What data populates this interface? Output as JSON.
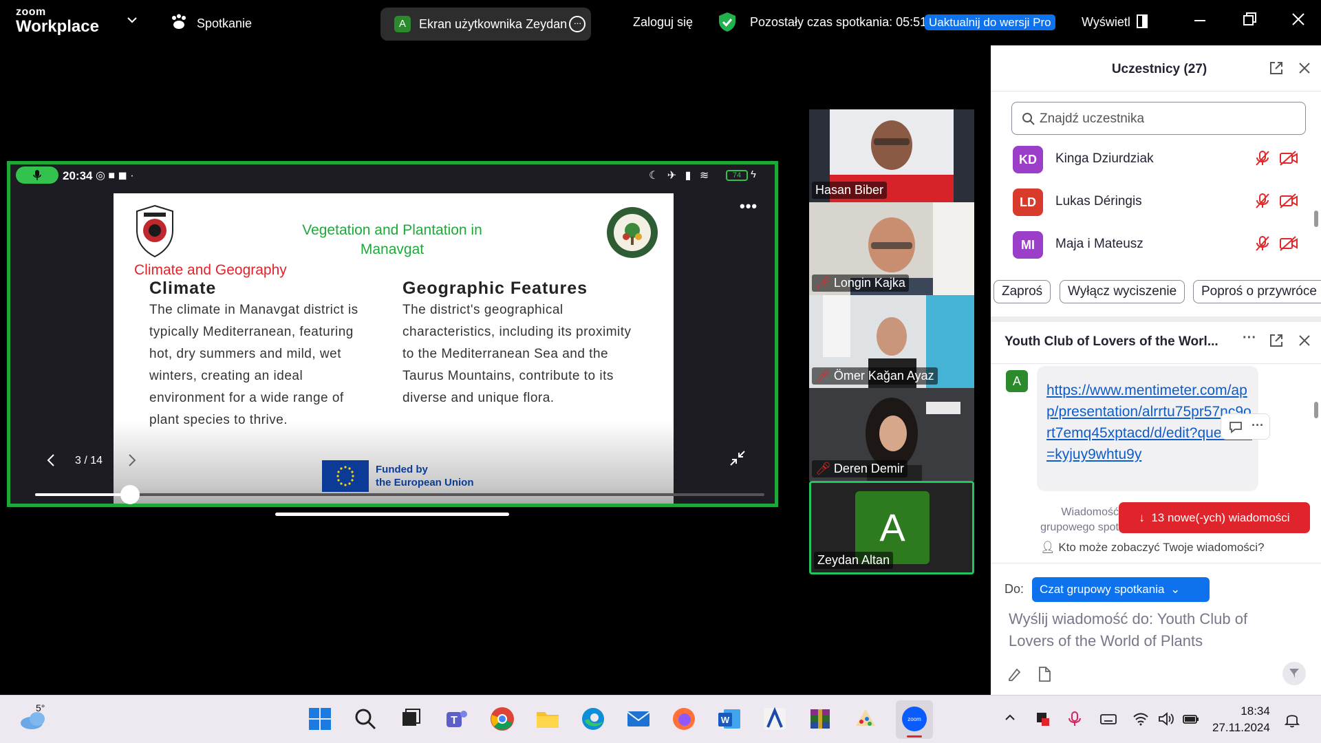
{
  "topbar": {
    "logo_small": "zoom",
    "logo_big": "Workplace",
    "meeting_label": "Spotkanie",
    "share_avatar": "A",
    "share_label": "Ekran użytkownika Zeydan",
    "login": "Zaloguj się",
    "time_left": "Pozostały czas spotkania: 05:51",
    "upgrade": "Uaktualnij do wersji Pro",
    "view": "Wyświetl"
  },
  "phone": {
    "time": "20:34",
    "battery": "74"
  },
  "slide": {
    "title": "Vegetation and Plantation in Manavgat",
    "section": "Climate and Geography",
    "col1_heading": "Climate",
    "col1_body": "The climate in Manavgat district is typically  Mediterranean, featuring hot, dry summers and  mild, wet winters, creating an ideal environment for  a wide range of plant species to thrive.",
    "col2_heading": "Geographic Features",
    "col2_body": "The district's geographical characteristics,  including its proximity to the Mediterranean Sea and the Taurus Mountains, contribute to its  diverse and unique flora.",
    "funded_line1": "Funded by",
    "funded_line2": "the European Union",
    "page": "3 / 14",
    "progress": 0.13
  },
  "participants_tiles": [
    {
      "name": "Hasan Biber",
      "muted": false
    },
    {
      "name": "Longin Kajka",
      "muted": true
    },
    {
      "name": "Ömer Kağan Ayaz",
      "muted": true
    },
    {
      "name": "Deren Demir",
      "muted": true
    },
    {
      "name": "Zeydan Altan",
      "muted": false,
      "avatar_letter": "A"
    }
  ],
  "participants_panel": {
    "title": "Uczestnicy (27)",
    "search_placeholder": "Znajdź uczestnika",
    "list": [
      {
        "initials": "KD",
        "name": "Kinga Dziurdziak",
        "color": "#9b3fc8"
      },
      {
        "initials": "LD",
        "name": "Lukas Déringis",
        "color": "#d83b2b"
      },
      {
        "initials": "MI",
        "name": "Maja i Mateusz",
        "color": "#9b3fc8"
      }
    ],
    "buttons": {
      "invite": "Zaproś",
      "unmute": "Wyłącz wyciszenie",
      "ask": "Poproś o przywróce"
    }
  },
  "chat": {
    "title": "Youth Club of Lovers of the Worl...",
    "sender_avatar": "A",
    "message_link": "https://www.mentimeter.com/app/presentation/alrrtu75pr57nc9ort7emq45xptacd/d/edit?question=kyjuy9whtu9y",
    "footer_line1": "Wiadomość",
    "footer_line2": "grupowego spot",
    "new_messages": "13 nowe(-ych) wiadomości",
    "who_can_see": "Kto może zobaczyć Twoje wiadomości?",
    "to_label": "Do:",
    "to_value": "Czat grupowy spotkania",
    "composer_placeholder": "Wyślij wiadomość do: Youth Club of Lovers of the World of Plants"
  },
  "taskbar": {
    "weather_temp": "5°",
    "time": "18:34",
    "date": "27.11.2024"
  },
  "colors": {
    "accent_blue": "#0e72ed",
    "active_green": "#1fa83a",
    "alert_red": "#e0242b"
  }
}
